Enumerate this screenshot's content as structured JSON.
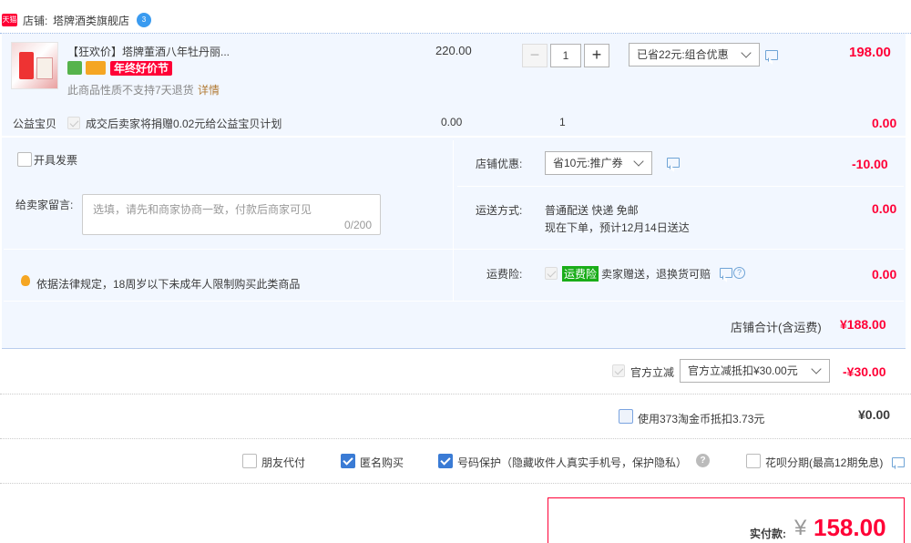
{
  "shop": {
    "badge": "天猫",
    "label": "店铺:",
    "name": "塔牌酒类旗舰店",
    "chat_badge": "3"
  },
  "product": {
    "title": "【狂欢价】塔牌董酒八年牡丹丽...",
    "promo_tag": "年终好价节",
    "no_return": "此商品性质不支持7天退货",
    "detail_link": "详情",
    "unit_price": "220.00",
    "quantity": "1",
    "discount_select": "已省22元:组合优惠",
    "subtotal": "198.00"
  },
  "charity": {
    "label": "公益宝贝",
    "desc": "成交后卖家将捐赠0.02元给公益宝贝计划",
    "price": "0.00",
    "qty": "1",
    "total": "0.00"
  },
  "invoice": {
    "label": "开具发票"
  },
  "shop_discount": {
    "label": "店铺优惠:",
    "select": "省10元:推广券",
    "amount": "-10.00"
  },
  "message": {
    "label": "给卖家留言:",
    "placeholder": "选填，请先和商家协商一致，付款后商家可见",
    "counter": "0/200"
  },
  "shipping": {
    "label": "运送方式:",
    "method": "普通配送 快递 免邮",
    "eta": "现在下单，预计12月14日送达",
    "amount": "0.00"
  },
  "notice": {
    "text": "依据法律规定，18周岁以下未成年人限制购买此类商品"
  },
  "insurance": {
    "label": "运费险:",
    "tag": "运费险",
    "desc": "卖家赠送，退换货可赔",
    "amount": "0.00"
  },
  "shop_total": {
    "label": "店铺合计(含运费)",
    "amount": "¥188.00"
  },
  "official": {
    "label": "官方立减",
    "select": "官方立减抵扣¥30.00元",
    "amount": "-¥30.00"
  },
  "taojinbi": {
    "label": "使用373淘金币抵扣3.73元",
    "amount": "¥0.00"
  },
  "options": {
    "friend_pay": "朋友代付",
    "anonymous": "匿名购买",
    "phone_protect": "号码保护（隐藏收件人真实手机号，保护隐私）",
    "huabei": "花呗分期(最高12期免息)"
  },
  "payment": {
    "label": "实付款:",
    "currency": "¥",
    "amount": "158.00"
  },
  "colors": {
    "accent": "#ff0036",
    "blue_bg": "#f2f7ff",
    "check_blue": "#3a7bd5",
    "ship_green": "#1aad19"
  }
}
